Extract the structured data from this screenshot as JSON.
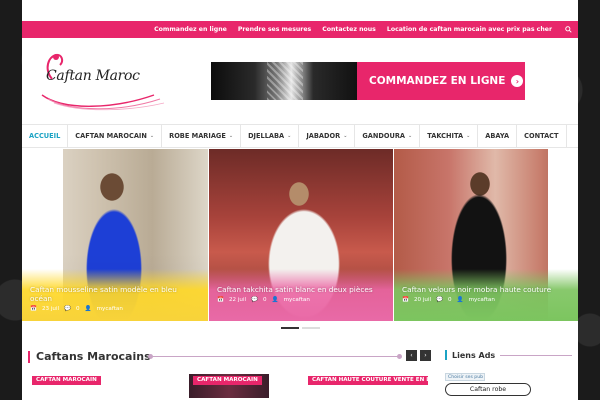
{
  "topbar": {
    "links": [
      "Commandez en ligne",
      "Prendre ses mesures",
      "Contactez nous",
      "Location de caftan marocain avec prix pas cher"
    ],
    "search_icon": "search-icon"
  },
  "header": {
    "logo_text": "Caftan Maroc",
    "banner_cta": "COMMANDEZ EN LIGNE",
    "banner_arrow": "›"
  },
  "nav": {
    "items": [
      {
        "label": "ACCUEIL",
        "caret": "",
        "active": true
      },
      {
        "label": "CAFTAN MAROCAIN",
        "caret": "⌄"
      },
      {
        "label": "ROBE MARIAGE",
        "caret": "⌄"
      },
      {
        "label": "DJELLABA",
        "caret": "⌄"
      },
      {
        "label": "JABADOR",
        "caret": "⌄"
      },
      {
        "label": "GANDOURA",
        "caret": "⌄"
      },
      {
        "label": "TAKCHITA",
        "caret": "⌄"
      },
      {
        "label": "ABAYA",
        "caret": ""
      },
      {
        "label": "CONTACT",
        "caret": ""
      }
    ]
  },
  "slider": {
    "slides": [
      {
        "title": "Caftan mousseline satin modèle en bleu océan",
        "date": "23 juil",
        "comments": "0",
        "author": "mycaftan"
      },
      {
        "title": "Caftan takchita satin blanc en deux pièces",
        "date": "22 juil",
        "comments": "0",
        "author": "mycaftan"
      },
      {
        "title": "Caftan velours noir mobra haute couture",
        "date": "20 juil",
        "comments": "0",
        "author": "mycaftan"
      }
    ],
    "icons": {
      "date": "📅",
      "comments": "💬",
      "author": "👤"
    }
  },
  "section": {
    "title": "Caftans Marocains",
    "prev": "‹",
    "next": "›",
    "thumbs": [
      {
        "tag": "CAFTAN MAROCAIN"
      },
      {
        "tag": "CAFTAN MAROCAIN"
      },
      {
        "tag": "CAFTAN HAUTE COUTURE VENTE EN LIGNE"
      }
    ]
  },
  "sidebar": {
    "title": "Liens Ads",
    "adchoices": "Choisir ses pub",
    "ad_button": "Caftan robe"
  },
  "colors": {
    "brand": "#e8266b",
    "accent": "#1ba3c4"
  }
}
